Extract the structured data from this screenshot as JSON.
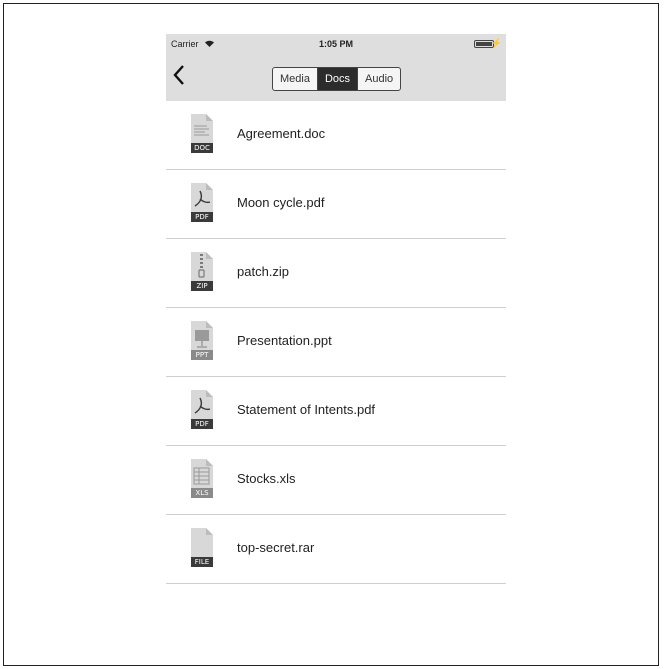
{
  "status_bar": {
    "carrier": "Carrier",
    "time": "1:05 PM"
  },
  "nav": {
    "back_icon": "chevron-left-icon",
    "segments": [
      {
        "label": "Media",
        "active": false
      },
      {
        "label": "Docs",
        "active": true
      },
      {
        "label": "Audio",
        "active": false
      }
    ]
  },
  "files": [
    {
      "name": "Agreement.doc",
      "type_label": "DOC",
      "icon": "doc-file-icon"
    },
    {
      "name": "Moon cycle.pdf",
      "type_label": "PDF",
      "icon": "pdf-file-icon"
    },
    {
      "name": "patch.zip",
      "type_label": "ZIP",
      "icon": "zip-file-icon"
    },
    {
      "name": "Presentation.ppt",
      "type_label": "PPT",
      "icon": "ppt-file-icon"
    },
    {
      "name": "Statement of Intents.pdf",
      "type_label": "PDF",
      "icon": "pdf-file-icon"
    },
    {
      "name": "Stocks.xls",
      "type_label": "XLS",
      "icon": "xls-file-icon"
    },
    {
      "name": "top-secret.rar",
      "type_label": "FILE",
      "icon": "generic-file-icon"
    }
  ],
  "colors": {
    "nav_background": "#dedede",
    "segment_active": "#2c2c2c",
    "file_tag": "#3a3a3a"
  }
}
